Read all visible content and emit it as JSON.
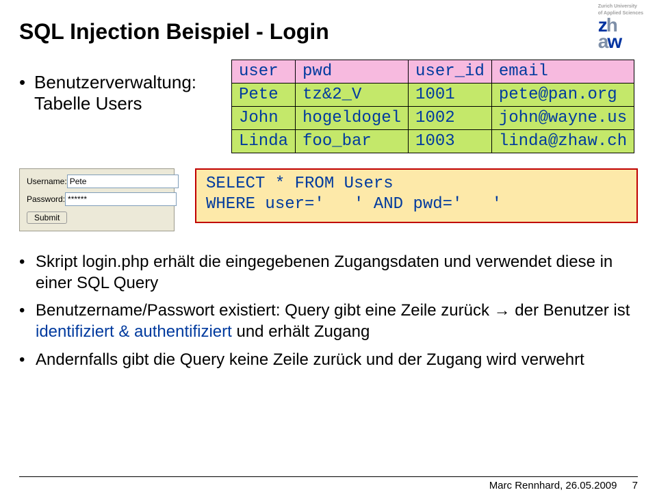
{
  "logo": {
    "tagline1": "Zurich University",
    "tagline2": "of Applied Sciences",
    "mark_line1_a": "z",
    "mark_line1_b": "h",
    "mark_line2_a": "a",
    "mark_line2_b": "w"
  },
  "title": "SQL Injection Beispiel - Login",
  "intro": {
    "line1": "Benutzerverwaltung:",
    "line2": "Tabelle Users"
  },
  "table": {
    "headers": [
      "user",
      "pwd",
      "user_id",
      "email"
    ],
    "rows": [
      [
        "Pete",
        "tz&2_V",
        "1001",
        "pete@pan.org"
      ],
      [
        "John",
        "hogeldogel",
        "1002",
        "john@wayne.us"
      ],
      [
        "Linda",
        "foo_bar",
        "1003",
        "linda@zhaw.ch"
      ]
    ]
  },
  "login": {
    "username_label": "Username:",
    "password_label": "Password:",
    "username_value": "Pete",
    "password_value": "******",
    "submit_label": "Submit"
  },
  "sql": "SELECT * FROM Users\nWHERE user='   ' AND pwd='   '",
  "bullets": [
    {
      "pre": "Skript login.php erhält die eingegebenen Zugangsdaten und verwendet diese in einer SQL Query",
      "ident": "",
      "post": ""
    },
    {
      "pre": "Benutzername/Passwort existiert: Query gibt eine Zeile zurück → der Benutzer ist ",
      "ident": "identifiziert & authentifiziert",
      "post": " und erhält Zugang"
    },
    {
      "pre": "Andernfalls gibt die Query keine Zeile zurück und der Zugang wird verwehrt",
      "ident": "",
      "post": ""
    }
  ],
  "footer": {
    "author_date": "Marc Rennhard, 26.05.2009",
    "page": "7"
  }
}
